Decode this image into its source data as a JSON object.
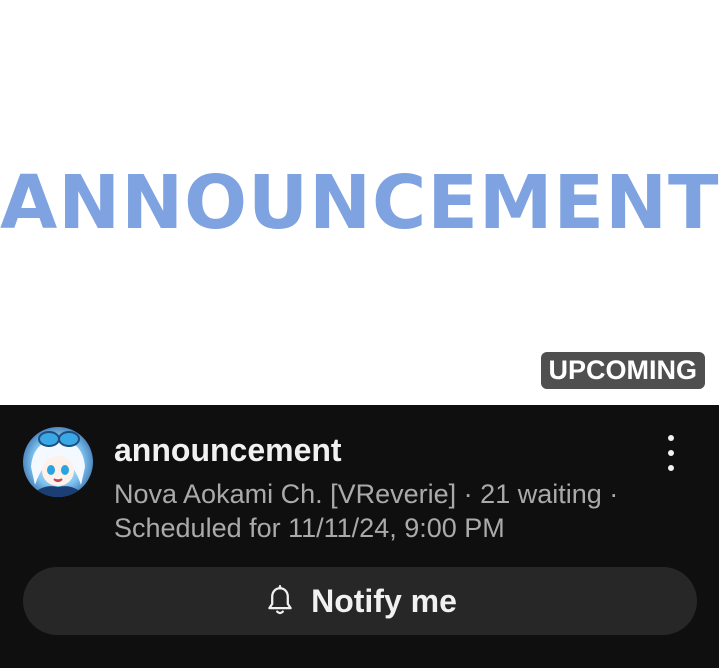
{
  "thumbnail": {
    "title_text": "ANNOUNCEMENT",
    "badge": "UPCOMING",
    "title_color": "#7ea3e0"
  },
  "video": {
    "title": "announcement",
    "channel": "Nova Aokami Ch. [VReverie]",
    "separator": "·",
    "waiting": "21 waiting",
    "scheduled": "Scheduled for 11/11/24, 9:00 PM"
  },
  "actions": {
    "notify_label": "Notify me",
    "notify_icon": "bell-icon",
    "more_icon": "more-vert-icon"
  },
  "colors": {
    "background": "#0f0f0f",
    "button": "#272727",
    "text_primary": "#f1f1f1",
    "text_secondary": "#aaaaaa"
  }
}
